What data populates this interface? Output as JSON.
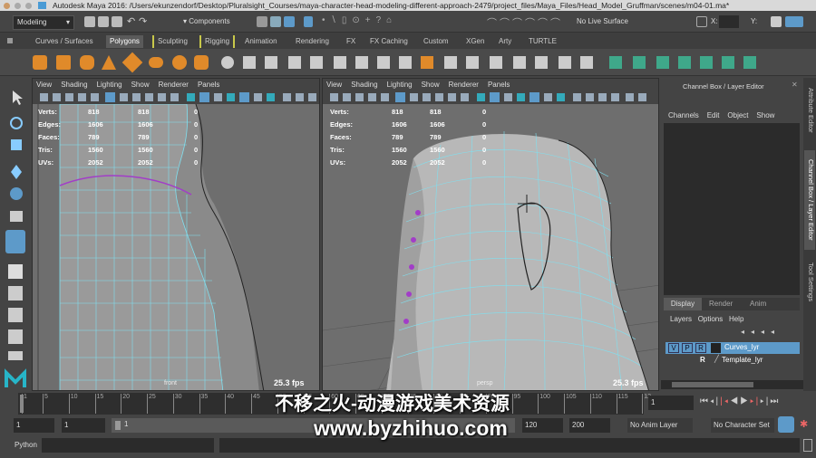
{
  "window": {
    "title": "Autodesk Maya 2016: /Users/ekunzendorf/Desktop/Pluralsight_Courses/maya-character-head-modeling-different-approach-2479/project_files/Maya_Files/Head_Model_Gruffman/scenes/m04-01.ma*"
  },
  "status_line": {
    "menu_set": "Modeling",
    "selection_mode": "Components",
    "live_surface": "No Live Surface",
    "x_label": "X:",
    "y_label": "Y:"
  },
  "shelf_tabs": [
    "Curves / Surfaces",
    "Polygons",
    "Sculpting",
    "Rigging",
    "Animation",
    "Rendering",
    "FX",
    "FX Caching",
    "Custom",
    "XGen",
    "Arty",
    "TURTLE"
  ],
  "shelf_active": "Polygons",
  "viewport_menu": [
    "View",
    "Shading",
    "Lighting",
    "Show",
    "Renderer",
    "Panels"
  ],
  "left_viewport": {
    "camera": "front",
    "fps": "25.3 fps",
    "hud": [
      [
        "Verts:",
        "818",
        "818",
        "0"
      ],
      [
        "Edges:",
        "1606",
        "1606",
        "0"
      ],
      [
        "Faces:",
        "789",
        "789",
        "0"
      ],
      [
        "Tris:",
        "1560",
        "1560",
        "0"
      ],
      [
        "UVs:",
        "2052",
        "2052",
        "0"
      ]
    ]
  },
  "right_viewport": {
    "camera": "persp",
    "fps": "25.3 fps",
    "hud": [
      [
        "Verts:",
        "818",
        "818",
        "0"
      ],
      [
        "Edges:",
        "1606",
        "1606",
        "0"
      ],
      [
        "Faces:",
        "789",
        "789",
        "0"
      ],
      [
        "Tris:",
        "1560",
        "1560",
        "0"
      ],
      [
        "UVs:",
        "2052",
        "2052",
        "0"
      ]
    ]
  },
  "channel_box": {
    "title": "Channel Box / Layer Editor",
    "menu": [
      "Channels",
      "Edit",
      "Object",
      "Show"
    ]
  },
  "layer_editor": {
    "tabs": [
      "Display",
      "Render",
      "Anim"
    ],
    "active_tab": "Display",
    "menu": [
      "Layers",
      "Options",
      "Help"
    ],
    "layers": [
      {
        "v": "V",
        "p": "P",
        "r": "R",
        "name": "Curves_lyr",
        "selected": true
      },
      {
        "v": "",
        "p": "",
        "r": "R",
        "name": "Template_lyr",
        "selected": false
      }
    ]
  },
  "side_tabs": [
    "Attribute Editor",
    "Channel Box / Layer Editor",
    "Tool Settings"
  ],
  "time_slider": {
    "ticks": [
      "1",
      "5",
      "10",
      "15",
      "20",
      "25",
      "30",
      "35",
      "40",
      "45",
      "50",
      "55",
      "60",
      "65",
      "70",
      "75",
      "80",
      "85",
      "90",
      "95",
      "100",
      "105",
      "110",
      "115",
      "12"
    ],
    "current_frame": "1"
  },
  "range_slider": {
    "start": "1",
    "playback_start": "1",
    "range_label": "1",
    "playback_end": "120",
    "end": "200",
    "anim_layer": "No Anim Layer",
    "character_set": "No Character Set"
  },
  "command_line": {
    "language": "Python"
  },
  "watermark": {
    "line1": "不移之火-动漫游戏美术资源",
    "line2": "www.byzhihuo.com"
  },
  "colors": {
    "accent": "#5d9ac9",
    "wire": "#7fe0f0",
    "vertex": "#a23dc8",
    "mesh": "#b5b5b5"
  }
}
